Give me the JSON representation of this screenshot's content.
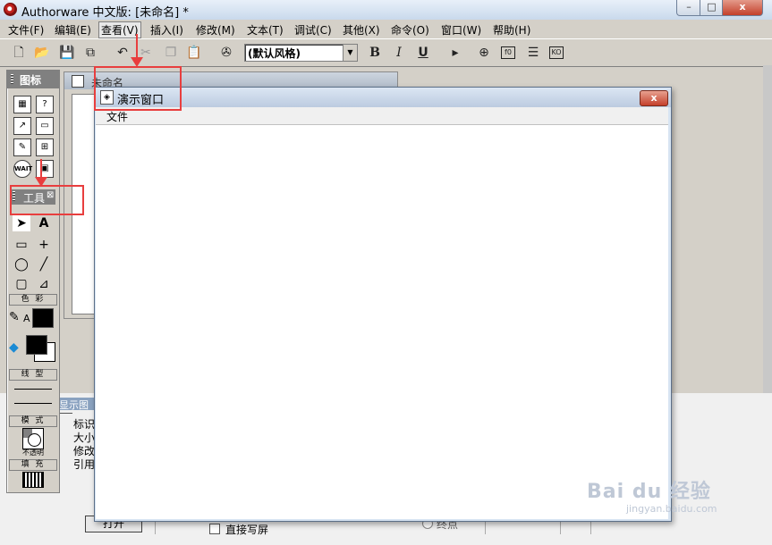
{
  "app": {
    "title": "Authorware 中文版: [未命名] *"
  },
  "window_controls": {
    "minimize": "–",
    "maximize": "□",
    "close": "x"
  },
  "menubar": {
    "items": [
      "文件(F)",
      "编辑(E)",
      "查看(V)",
      "插入(I)",
      "修改(M)",
      "文本(T)",
      "调试(C)",
      "其他(X)",
      "命令(O)",
      "窗口(W)",
      "帮助(H)"
    ]
  },
  "toolbar": {
    "style_select_value": "(默认风格)",
    "bold": "B",
    "italic": "I",
    "underline": "U"
  },
  "icon_palette": {
    "title": "图标",
    "wait_label": "WAIT"
  },
  "tools_panel": {
    "title": "工具",
    "text_tool": "A",
    "color_label": "色 彩",
    "line_label": "线 型",
    "mode_label": "模 式",
    "opaque_label": "不透明",
    "fill_label": "填 充"
  },
  "back_window": {
    "title": "未命名"
  },
  "properties": {
    "header": "显示图标",
    "lines": [
      "标识",
      "大小",
      "修改",
      "引用"
    ]
  },
  "bottom": {
    "open_button": "打开",
    "direct_write_label": "直接写屏",
    "end_label": "终点"
  },
  "presentation_window": {
    "title": "演示窗口",
    "menu_file": "文件",
    "close": "x"
  },
  "watermark": {
    "text": "Bai du 经验",
    "sub": "jingyan.baidu.com"
  },
  "colors": {
    "annotation_red": "#e83e3e",
    "titlebar": "#c9d9ec"
  }
}
